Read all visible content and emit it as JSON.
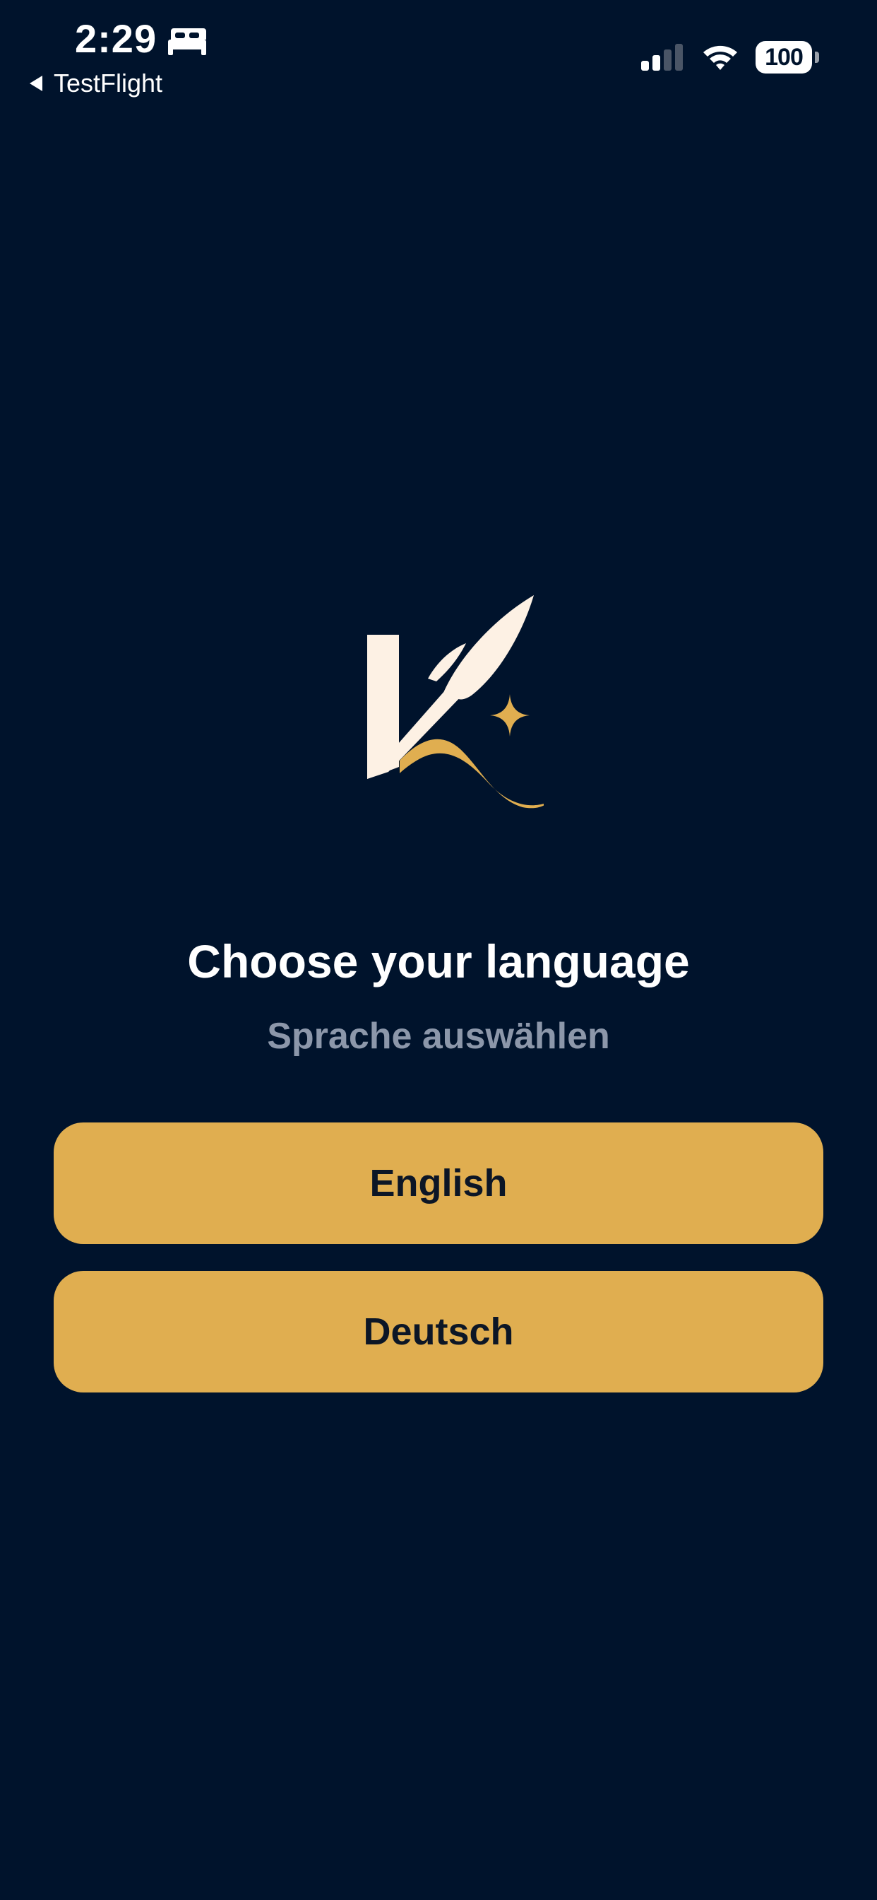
{
  "status_bar": {
    "time": "2:29",
    "back_label": "TestFlight",
    "battery_level": "100",
    "icons": [
      "bed-icon",
      "back-arrow-icon",
      "cellular-signal-icon",
      "wifi-icon",
      "battery-icon"
    ]
  },
  "logo": {
    "icon": "quill-k-logo-icon"
  },
  "title": "Choose your language",
  "subtitle": "Sprache auswählen",
  "buttons": {
    "english": "English",
    "deutsch": "Deutsch"
  },
  "colors": {
    "background": "#00132C",
    "accent": "#E0AE50",
    "logo_cream": "#FDF1E4",
    "subtitle": "#8C97AA",
    "button_text": "#0C1626"
  }
}
